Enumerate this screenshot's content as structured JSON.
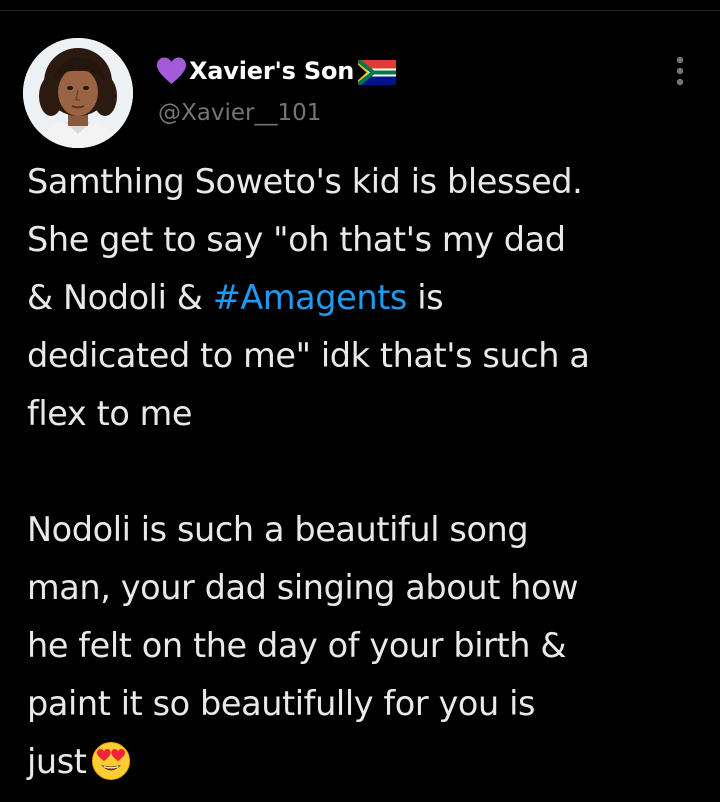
{
  "tweet": {
    "author": {
      "display_name": "Xavier's Son",
      "name_prefix_icon": "purple-heart-icon",
      "name_suffix_icon": "south-africa-flag-icon",
      "handle": "@Xavier__101",
      "avatar": "profile-photo"
    },
    "menu_icon": "more-vertical-icon",
    "paragraph1": {
      "line1": "Samthing Soweto's kid is blessed.",
      "line2": "She get to say \"oh that's my dad",
      "line3_before": "& Nodoli & ",
      "hashtag": "#Amagents",
      "line3_after": " is",
      "line4": "dedicated to me\" idk that's such a",
      "line5": "flex to me"
    },
    "paragraph2": {
      "line1": "Nodoli is such a beautiful song",
      "line2": "man, your dad singing about how",
      "line3": "he felt on the day of your birth &",
      "line4": "paint it so beautifully for you is",
      "line5": "just",
      "end_emoji": "heart-eyes-emoji-icon"
    }
  },
  "colors": {
    "background": "#000000",
    "text": "#e7e9ea",
    "secondary_text": "#71767b",
    "link": "#1d9bf0",
    "heart": "#a25ad8"
  }
}
